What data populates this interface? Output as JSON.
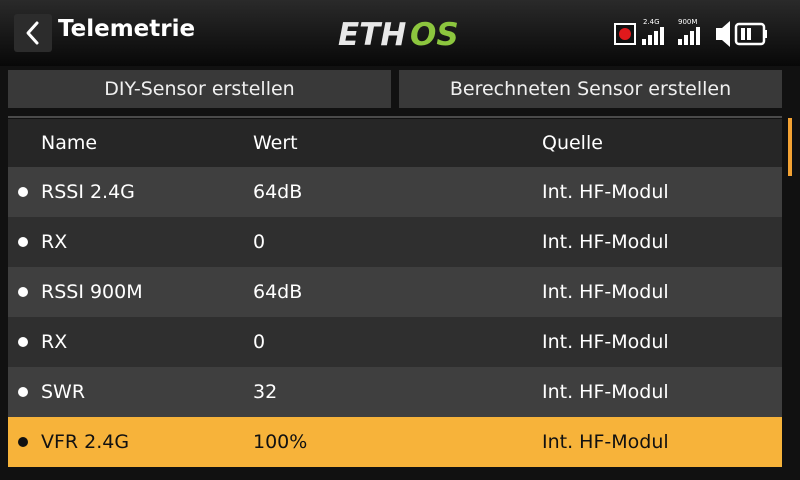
{
  "header": {
    "title": "Telemetrie",
    "logo_text": "ETHOS",
    "logo_colors": {
      "eth": "#e8e8e8",
      "os": "#8cc63e"
    },
    "status_icons": {
      "record": "record-icon",
      "signal_24_label": "2.4G",
      "signal_900_label": "900M",
      "volume": "volume-icon",
      "battery": "battery-icon"
    }
  },
  "actions": {
    "diy_sensor": "DIY-Sensor erstellen",
    "calc_sensor": "Berechneten Sensor erstellen"
  },
  "table": {
    "columns": {
      "name": "Name",
      "value": "Wert",
      "source": "Quelle"
    },
    "rows": [
      {
        "name": "RSSI 2.4G",
        "value": "64dB",
        "source": "Int. HF-Modul"
      },
      {
        "name": "RX",
        "value": "0",
        "source": "Int. HF-Modul"
      },
      {
        "name": "RSSI 900M",
        "value": "64dB",
        "source": "Int. HF-Modul"
      },
      {
        "name": "RX",
        "value": "0",
        "source": "Int. HF-Modul"
      },
      {
        "name": "SWR",
        "value": "32",
        "source": "Int. HF-Modul"
      },
      {
        "name": "VFR 2.4G",
        "value": "100%",
        "source": "Int. HF-Modul"
      }
    ],
    "selected_index": 5
  },
  "colors": {
    "accent": "#f7b33a",
    "row_odd": "#3f3f3f",
    "row_even": "#2f2f2f"
  }
}
